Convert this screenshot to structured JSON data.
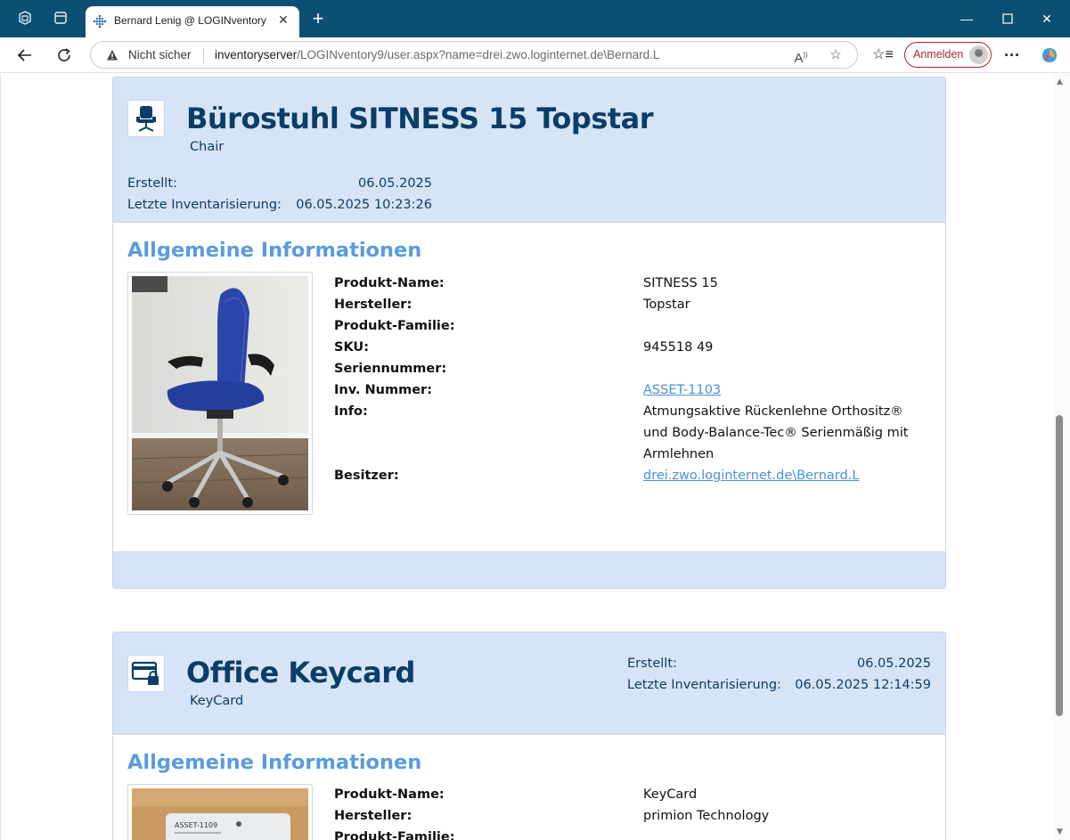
{
  "browser": {
    "tab_title": "Bernard Lenig @ LOGINventory",
    "not_secure_label": "Nicht sicher",
    "url_host": "inventoryserver",
    "url_path": "/LOGINventory9/user.aspx?name=drei.zwo.loginternet.de\\Bernard.L",
    "signin_label": "Anmelden"
  },
  "assets": [
    {
      "title": "Bürostuhl SITNESS 15 Topstar",
      "type": "Chair",
      "icon": "chair-icon",
      "created_label": "Erstellt:",
      "created_value": "06.05.2025",
      "inventory_label": "Letzte Inventarisierung:",
      "inventory_value": "06.05.2025 10:23:26",
      "section_title": "Allgemeine Informationen",
      "fields": [
        {
          "label": "Produkt-Name:",
          "value": "SITNESS 15"
        },
        {
          "label": "Hersteller:",
          "value": "Topstar"
        },
        {
          "label": "Produkt-Familie:",
          "value": ""
        },
        {
          "label": "SKU:",
          "value": "945518 49"
        },
        {
          "label": "Seriennummer:",
          "value": ""
        },
        {
          "label": "Inv. Nummer:",
          "value": "ASSET-1103"
        },
        {
          "label": "Info:",
          "value": "Atmungsaktive Rückenlehne Orthositz® und Body-Balance-Tec® Serienmäßig mit Armlehnen"
        },
        {
          "label": "Besitzer:",
          "value": "drei.zwo.loginternet.de\\Bernard.L"
        }
      ]
    },
    {
      "title": "Office Keycard",
      "type": "KeyCard",
      "icon": "keycard-icon",
      "created_label": "Erstellt:",
      "created_value": "06.05.2025",
      "inventory_label": "Letzte Inventarisierung:",
      "inventory_value": "06.05.2025 12:14:59",
      "section_title": "Allgemeine Informationen",
      "photo_text": "ASSET-1109",
      "fields": [
        {
          "label": "Produkt-Name:",
          "value": "KeyCard"
        },
        {
          "label": "Hersteller:",
          "value": "primion Technology"
        },
        {
          "label": "Produkt-Familie:",
          "value": ""
        }
      ]
    }
  ],
  "colors": {
    "titlebar": "#0b4f73",
    "card_header": "#d6e4f8",
    "title_text": "#0b3d66",
    "section_title": "#5b9bd9",
    "link": "#4a90d9"
  }
}
